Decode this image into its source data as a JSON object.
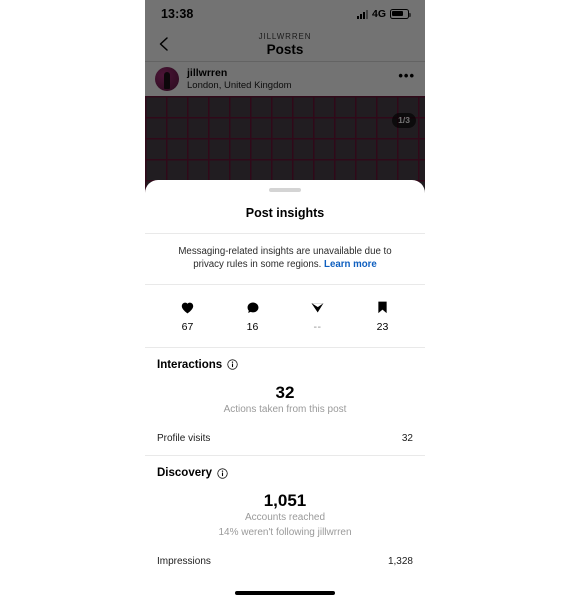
{
  "status_bar": {
    "time": "13:38",
    "network": "4G",
    "signal_icon": "signal-bars-icon",
    "battery_icon": "battery-icon"
  },
  "nav": {
    "back_icon": "chevron-left-icon",
    "eyebrow": "JILLWRREN",
    "title": "Posts"
  },
  "post_header": {
    "username": "jillwrren",
    "location": "London, United Kingdom",
    "more_label": "•••",
    "avatar_icon": "avatar"
  },
  "media": {
    "carousel_badge": "1/3",
    "background_color": "#4b4249",
    "grid_line_color": "#6b1638"
  },
  "sheet": {
    "title": "Post insights",
    "grabber_icon": "drag-handle-icon",
    "privacy_notice": "Messaging-related insights are unavailable due to privacy rules in some regions.",
    "privacy_link": "Learn more",
    "metrics": [
      {
        "icon": "heart-icon",
        "value": "67"
      },
      {
        "icon": "comment-icon",
        "value": "16"
      },
      {
        "icon": "share-icon",
        "value": "--"
      },
      {
        "icon": "bookmark-icon",
        "value": "23"
      }
    ],
    "interactions": {
      "heading": "Interactions",
      "info_icon": "info-icon",
      "big_number": "32",
      "big_caption": "Actions taken from this post",
      "rows": [
        {
          "label": "Profile visits",
          "value": "32"
        }
      ]
    },
    "discovery": {
      "heading": "Discovery",
      "info_icon": "info-icon",
      "big_number": "1,051",
      "big_caption": "Accounts reached",
      "big_caption_2": "14% weren't following jillwrren",
      "rows": [
        {
          "label": "Impressions",
          "value": "1,328"
        }
      ]
    }
  },
  "home_indicator": "home-indicator",
  "colors": {
    "link": "#0f5fbf",
    "muted": "#9a9a9a",
    "divider": "#e9e9e9"
  }
}
